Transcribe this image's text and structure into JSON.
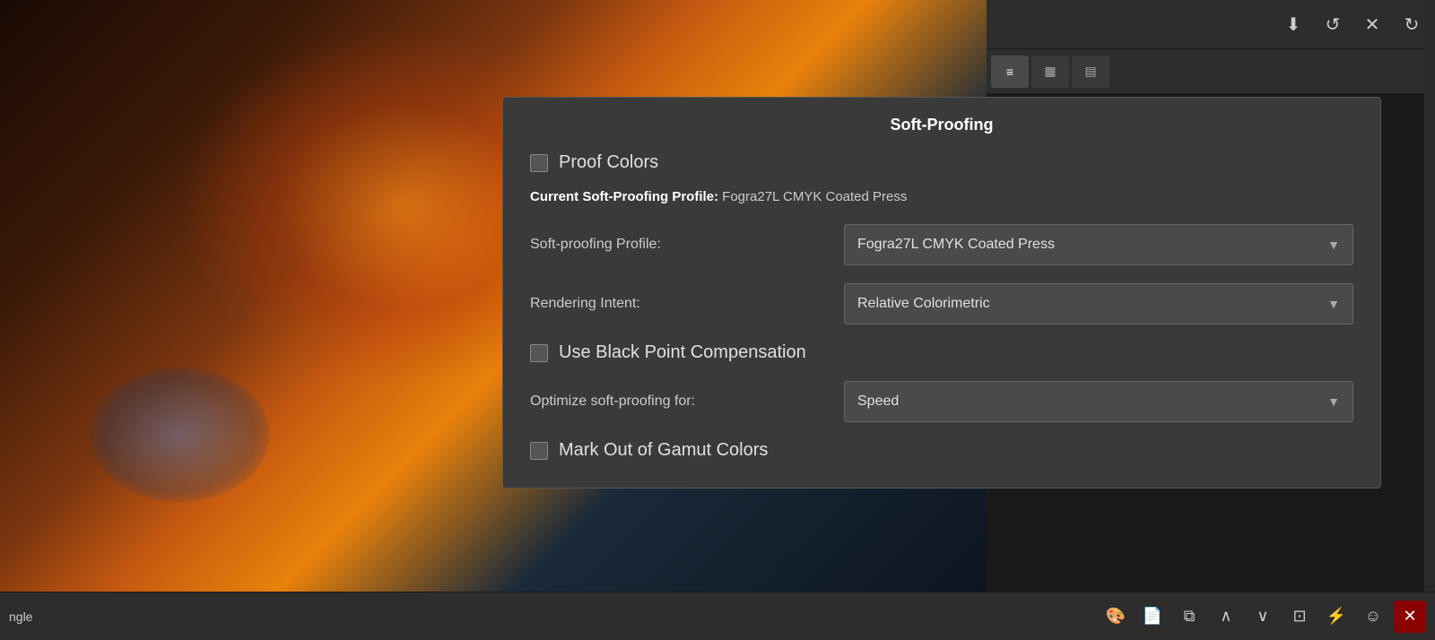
{
  "app": {
    "title": "Soft-Proofing"
  },
  "toolbar": {
    "icons": [
      {
        "name": "download-icon",
        "symbol": "⬇",
        "label": "Download"
      },
      {
        "name": "undo-icon",
        "symbol": "↺",
        "label": "Undo"
      },
      {
        "name": "close-icon",
        "symbol": "✕",
        "label": "Close"
      },
      {
        "name": "redo-icon",
        "symbol": "↻",
        "label": "Redo"
      }
    ],
    "more_label": "..."
  },
  "panel_tabs": [
    {
      "name": "layers-tab",
      "symbol": "≡",
      "active": true
    },
    {
      "name": "channels-tab",
      "symbol": "▦",
      "active": false
    },
    {
      "name": "histogram-tab",
      "symbol": "▤",
      "active": false
    }
  ],
  "soft_proofing": {
    "title": "Soft-Proofing",
    "proof_colors_label": "Proof Colors",
    "proof_colors_checked": false,
    "current_profile_prefix": "Current Soft-Proofing Profile:",
    "current_profile_value": "Fogra27L CMYK Coated Press",
    "profile_label": "Soft-proofing Profile:",
    "profile_value": "Fogra27L CMYK Coated Press",
    "rendering_label": "Rendering Intent:",
    "rendering_value": "Relative Colorimetric",
    "black_point_label": "Use Black Point Compensation",
    "black_point_checked": false,
    "optimize_label": "Optimize soft-proofing for:",
    "optimize_value": "Speed",
    "gamut_label": "Mark Out of Gamut Colors",
    "gamut_checked": false
  },
  "bottom_bar": {
    "text": "ngle",
    "icons": [
      {
        "name": "color-picker-icon",
        "symbol": "🎨"
      },
      {
        "name": "new-layer-icon",
        "symbol": "📄"
      },
      {
        "name": "duplicate-icon",
        "symbol": "⧉"
      },
      {
        "name": "move-up-icon",
        "symbol": "∧"
      },
      {
        "name": "move-down-icon",
        "symbol": "∨"
      },
      {
        "name": "fit-icon",
        "symbol": "⊡"
      },
      {
        "name": "stack-icon",
        "symbol": "⚡"
      },
      {
        "name": "mask-icon",
        "symbol": "😐"
      },
      {
        "name": "close-bottom-icon",
        "symbol": "✕"
      }
    ]
  }
}
